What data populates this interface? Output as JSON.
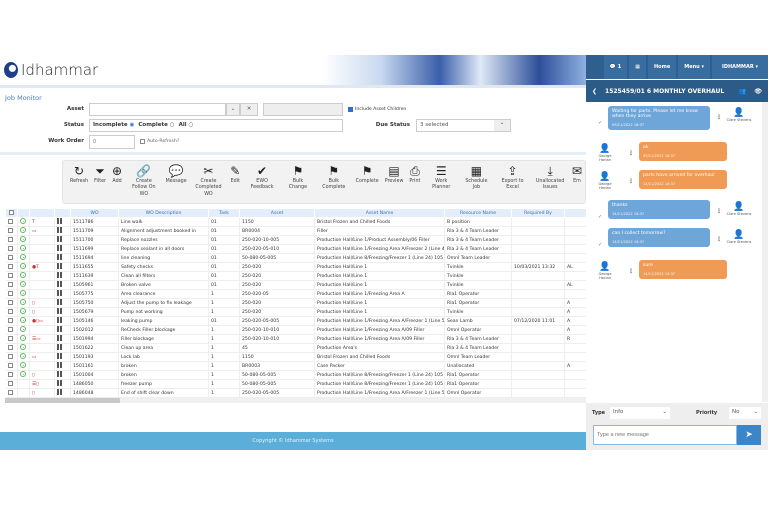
{
  "brand": "Idhammar",
  "page_title": "Job Monitor",
  "filters": {
    "asset_label": "Asset",
    "asset_value": "",
    "include_children_label": "Include Asset Children",
    "include_children": true,
    "status_label": "Status",
    "status_options": [
      "Incomplete",
      "Complete",
      "All"
    ],
    "status_selected": "Incomplete",
    "due_status_label": "Due Status",
    "due_status_value": "3 selected",
    "work_order_label": "Work Order",
    "work_order_placeholder": "0",
    "auto_refresh_label": "Auto-Refresh?"
  },
  "toolbar": [
    {
      "icon": "↻",
      "label": "Refresh"
    },
    {
      "icon": "⏷",
      "label": "Filter"
    },
    {
      "icon": "⊕",
      "label": "Add"
    },
    {
      "icon": "🔗",
      "label": "Create Follow On WO"
    },
    {
      "icon": "💬",
      "label": "Message"
    },
    {
      "icon": "✂",
      "label": "Create Completed WO"
    },
    {
      "icon": "✎",
      "label": "Edit"
    },
    {
      "icon": "✔",
      "label": "EWO Feedback"
    },
    {
      "icon": "⚑",
      "label": "Bulk Change"
    },
    {
      "icon": "⚑",
      "label": "Bulk Complete"
    },
    {
      "icon": "⚑",
      "label": "Complete"
    },
    {
      "icon": "▤",
      "label": "Preview"
    },
    {
      "icon": "⎙",
      "label": "Print"
    },
    {
      "icon": "☰",
      "label": "Work Planner"
    },
    {
      "icon": "▦",
      "label": "Schedule Job"
    },
    {
      "icon": "⇪",
      "label": "Export to Excel"
    },
    {
      "icon": "⤓",
      "label": "Unallocated Issues"
    },
    {
      "icon": "✉",
      "label": "Em"
    }
  ],
  "columns": [
    "WO",
    "WO Description",
    "Task",
    "Asset",
    "Asset Name",
    "Resource Name",
    "Required By"
  ],
  "rows": [
    {
      "status": true,
      "icons": "T",
      "wo": "1511786",
      "desc": "Line walk",
      "task": "01",
      "asset": "1150",
      "asset_name": "Bristol Frozen and Chilled Foods",
      "resource": "B position",
      "required": "",
      "extra": ""
    },
    {
      "status": true,
      "icons": "▭",
      "wo": "1511709",
      "desc": "Alignment adjustment booked in",
      "task": "01",
      "asset": "BR0004",
      "asset_name": "Filler",
      "resource": "Rla 3 & 4 Team Leader",
      "required": "",
      "extra": ""
    },
    {
      "status": true,
      "icons": "",
      "wo": "1511700",
      "desc": "Replace nozzles",
      "task": "01",
      "asset": "250-020-10-005",
      "asset_name": "Production Hall/Line 1/Product Assembly/06 Filler",
      "resource": "Rla 3 & 4 Team Leader",
      "required": "",
      "extra": ""
    },
    {
      "status": true,
      "icons": "",
      "wo": "1511699",
      "desc": "Replace sealant in all doors",
      "task": "01",
      "asset": "250-020-05-010",
      "asset_name": "Production Hall/Line 1/Freezing Area A/Freezer 2 (Line 49)",
      "resource": "Rla 3 & 4 Team Leader",
      "required": "",
      "extra": ""
    },
    {
      "status": true,
      "icons": "",
      "wo": "1511694",
      "desc": "line cleaning",
      "task": "01",
      "asset": "50-080-05-005",
      "asset_name": "Production Hall/Line 8/Freezing/Freezer 1 (Line 24) 105",
      "resource": "Omnl Team Leader",
      "required": "",
      "extra": ""
    },
    {
      "status": true,
      "icons": "●T",
      "wo": "1511655",
      "desc": "Safety checks",
      "task": "01",
      "asset": "250-020",
      "asset_name": "Production Hall/Line 1",
      "resource": "Tvinkle",
      "required": "10/03/2021 13:32",
      "extra": "AL"
    },
    {
      "status": true,
      "icons": "",
      "wo": "1511639",
      "desc": "Clean all filters",
      "task": "01",
      "asset": "250-020",
      "asset_name": "Production Hall/Line 1",
      "resource": "Tvinkle",
      "required": "",
      "extra": ""
    },
    {
      "status": true,
      "icons": "",
      "wo": "1505961",
      "desc": "Broken valve",
      "task": "01",
      "asset": "250-020",
      "asset_name": "Production Hall/Line 1",
      "resource": "Tvinkle",
      "required": "",
      "extra": "AL"
    },
    {
      "status": true,
      "icons": "",
      "wo": "1505775",
      "desc": "Area clearance",
      "task": "1",
      "asset": "250-020-05",
      "asset_name": "Production Hall/Line 1/Freezing Area A",
      "resource": "Rla1 Operator",
      "required": "",
      "extra": ""
    },
    {
      "status": true,
      "icons": "▯",
      "wo": "1505750",
      "desc": "Adjust the pump to fix leakage",
      "task": "1",
      "asset": "250-020",
      "asset_name": "Production Hall/Line 1",
      "resource": "Rla1 Operator",
      "required": "",
      "extra": "A"
    },
    {
      "status": true,
      "icons": "▯",
      "wo": "1505679",
      "desc": "Pump not working",
      "task": "1",
      "asset": "250-020",
      "asset_name": "Production Hall/Line 1",
      "resource": "Tvinkle",
      "required": "",
      "extra": "A"
    },
    {
      "status": true,
      "icons": "●▯▭",
      "wo": "1505146",
      "desc": "leaking pump",
      "task": "01",
      "asset": "250-020-05-005",
      "asset_name": "Production Hall/Line 1/Freezing Area A/Freezer 1 (Line 50)",
      "resource": "Sean Lamb",
      "required": "07/12/2020 11:01",
      "extra": "A"
    },
    {
      "status": true,
      "icons": "",
      "wo": "1502012",
      "desc": "ReCheck Filler blockage",
      "task": "1",
      "asset": "250-020-10-010",
      "asset_name": "Production Hall/Line 1/Freezing Area A/09 Filler",
      "resource": "Omnl Operator",
      "required": "",
      "extra": "A"
    },
    {
      "status": true,
      "icons": "☰▭",
      "wo": "1501994",
      "desc": "Filler blockage",
      "task": "1",
      "asset": "250-020-10-010",
      "asset_name": "Production Hall/Line 1/Freezing Area A/09 Filler",
      "resource": "Rla 3 & 4 Team Leader",
      "required": "",
      "extra": "R"
    },
    {
      "status": true,
      "icons": "",
      "wo": "1501622",
      "desc": "Clean up area",
      "task": "1",
      "asset": "45",
      "asset_name": "Production Area's",
      "resource": "Rla 3 & 4 Team Leader",
      "required": "",
      "extra": ""
    },
    {
      "status": true,
      "icons": "▭",
      "wo": "1501193",
      "desc": "Lock lab",
      "task": "1",
      "asset": "1150",
      "asset_name": "Bristol Frozen and Chilled Foods",
      "resource": "Omnl Team Leader",
      "required": "",
      "extra": ""
    },
    {
      "status": true,
      "icons": "",
      "wo": "1501161",
      "desc": "broken",
      "task": "1",
      "asset": "BR0003",
      "asset_name": "Case Packer",
      "resource": "Unallocated",
      "required": "",
      "extra": "A"
    },
    {
      "status": true,
      "icons": "▯",
      "wo": "1501004",
      "desc": "broken",
      "task": "1",
      "asset": "50-080-05-005",
      "asset_name": "Production Hall/Line 8/Freezing/Freezer 1 (Line 24) 105",
      "resource": "Rla1 Operator",
      "required": "",
      "extra": ""
    },
    {
      "status": false,
      "icons": "☰▯",
      "wo": "1486050",
      "desc": "freezer pump",
      "task": "1",
      "asset": "50-080-05-005",
      "asset_name": "Production Hall/Line 8/Freezing/Freezer 1 (Line 24) 105",
      "resource": "Rla1 Operator",
      "required": "",
      "extra": ""
    },
    {
      "status": false,
      "icons": "▯",
      "wo": "1486048",
      "desc": "End of shift clear down",
      "task": "1",
      "asset": "250-020-05-005",
      "asset_name": "Production Hall/Line 1/Freezing Area A/Freezer 1 (Line 50)",
      "resource": "Omnl Operator",
      "required": "",
      "extra": ""
    }
  ],
  "footer": "Copyright © Idhammar Systems",
  "nav": {
    "messages_count": "1",
    "home": "Home",
    "menu": "Menu",
    "user": "IDHAMMAR"
  },
  "chat": {
    "title": "1525459/01 6 MONTHLY OVERHAUL",
    "messages": [
      {
        "side": "right",
        "text": "Waiting for parts. Please let me know when they arrive",
        "time": "09/11/2022 16:37",
        "author": "Clare Stevens"
      },
      {
        "side": "left",
        "text": "ok",
        "time": "09/11/2022 16:37",
        "author": "George Harlan"
      },
      {
        "side": "left",
        "text": "parts have arrived for overhaul",
        "time": "14/11/2022 14:37",
        "author": "George Harlan"
      },
      {
        "side": "right",
        "text": "thanks",
        "time": "14/11/2022 14:37",
        "author": "Clare Stevens"
      },
      {
        "side": "right",
        "text": "can I collect tomorrow?",
        "time": "14/11/2022 14:37",
        "author": "Clare Stevens"
      },
      {
        "side": "left",
        "text": "sure",
        "time": "14/11/2022 14:37",
        "author": "George Harlan"
      }
    ],
    "type_label": "Type",
    "type_value": "Info",
    "priority_label": "Priority",
    "priority_value": "No",
    "input_placeholder": "Type a new message"
  },
  "colors": {
    "accent": "#2f5f8e",
    "footer": "#5aaed8",
    "bubble_blue": "#6fa6d9",
    "bubble_orange": "#ef9a55",
    "status_green": "#5cb85c"
  }
}
